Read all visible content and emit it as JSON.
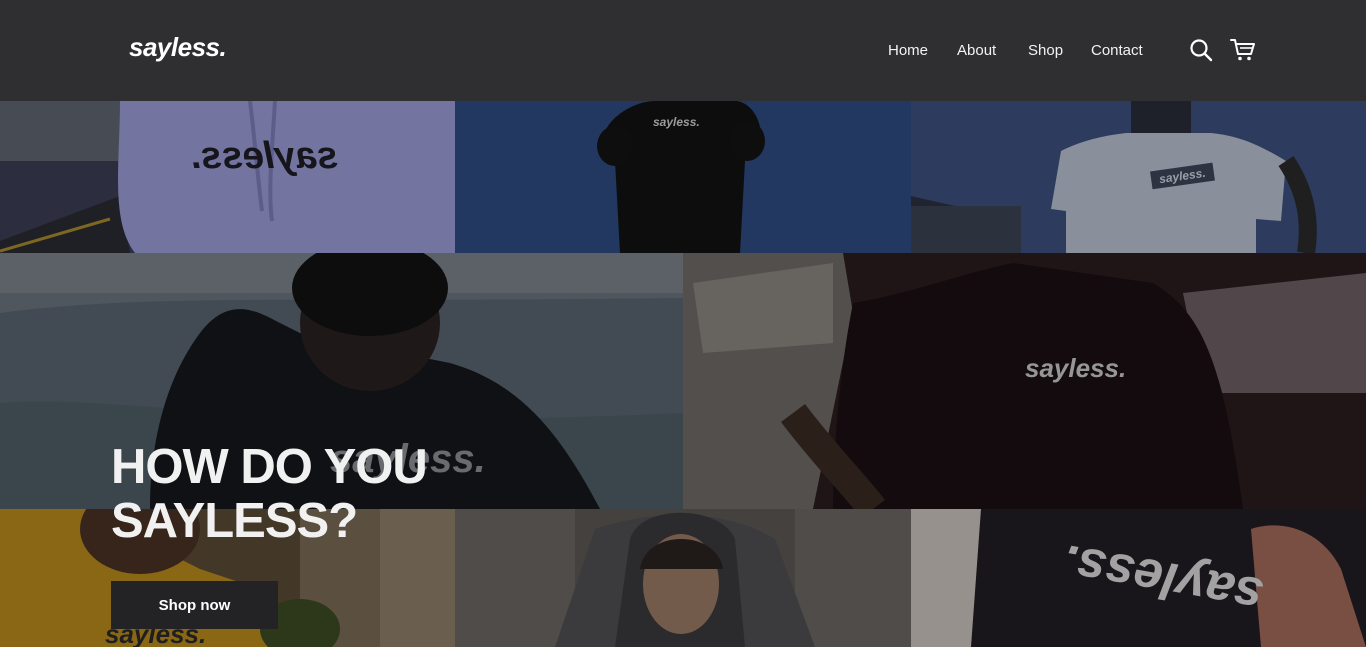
{
  "brand": {
    "logo": "sayless."
  },
  "nav": {
    "items": [
      {
        "label": "Home"
      },
      {
        "label": "About"
      },
      {
        "label": "Shop"
      },
      {
        "label": "Contact"
      }
    ]
  },
  "icons": {
    "search": "search-icon",
    "cart": "cart-icon"
  },
  "hero": {
    "title_line1": "HOW DO YOU",
    "title_line2": "SAYLESS?",
    "cta_label": "Shop now"
  },
  "gallery": {
    "prints": [
      {
        "text": "sayless."
      },
      {
        "text": "sayless."
      },
      {
        "text": "sayless."
      },
      {
        "text": "sayless."
      },
      {
        "text": "sayless."
      },
      {
        "text": "sayless."
      },
      {
        "text": "sayless."
      }
    ]
  },
  "colors": {
    "header_bg": "#2f2f31",
    "button_bg": "#232325",
    "text": "#ffffff"
  }
}
